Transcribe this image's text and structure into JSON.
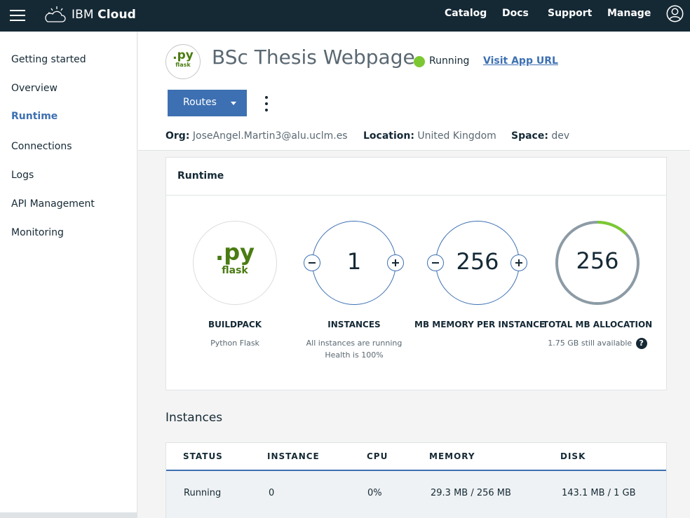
{
  "topbar": {
    "brand_prefix": "IBM",
    "brand_suffix": "Cloud",
    "nav": [
      "Catalog",
      "Docs",
      "Support",
      "Manage"
    ],
    "menu_icon": "hamburger-menu-icon",
    "logo_icon": "cloud-logo-icon",
    "user_icon": "user-avatar-icon"
  },
  "sidebar": {
    "items": [
      {
        "label": "Getting started"
      },
      {
        "label": "Overview"
      },
      {
        "label": "Runtime"
      },
      {
        "label": "Connections"
      },
      {
        "label": "Logs"
      },
      {
        "label": "API Management"
      },
      {
        "label": "Monitoring"
      }
    ],
    "active": "Runtime"
  },
  "app": {
    "logo_main": ".py",
    "logo_sub": "flask",
    "title": "BSc Thesis Webpage",
    "status": "Running",
    "status_color": "#7cc832",
    "visit_link": "Visit App URL",
    "routes_button": "Routes",
    "org_label": "Org:",
    "org": "JoseAngel.Martin3@alu.uclm.es",
    "location_label": "Location:",
    "location": "United Kingdom",
    "space_label": "Space:",
    "space": "dev"
  },
  "runtime": {
    "title": "Runtime",
    "buildpack": {
      "logo_main": ".py",
      "logo_sub": "flask",
      "label": "BUILDPACK",
      "sub": "Python Flask"
    },
    "instances": {
      "value": "1",
      "label": "INSTANCES",
      "sub1": "All instances are running",
      "sub2": "Health is 100%"
    },
    "memory": {
      "value": "256",
      "label": "MB MEMORY PER INSTANCE"
    },
    "total": {
      "value": "256",
      "label": "TOTAL MB ALLOCATION",
      "sub": "1.75 GB still available",
      "help": "?",
      "allocation_fraction": 0.125
    },
    "colors": {
      "accent": "#3d70b2",
      "gauge_fill": "#7cc832",
      "gauge_track": "#8c9ba5"
    }
  },
  "instances": {
    "title": "Instances",
    "columns": [
      "STATUS",
      "INSTANCE",
      "CPU",
      "MEMORY",
      "DISK"
    ],
    "rows": [
      [
        "Running",
        "0",
        "0%",
        "29.3 MB / 256 MB",
        "143.1 MB / 1 GB"
      ]
    ]
  }
}
